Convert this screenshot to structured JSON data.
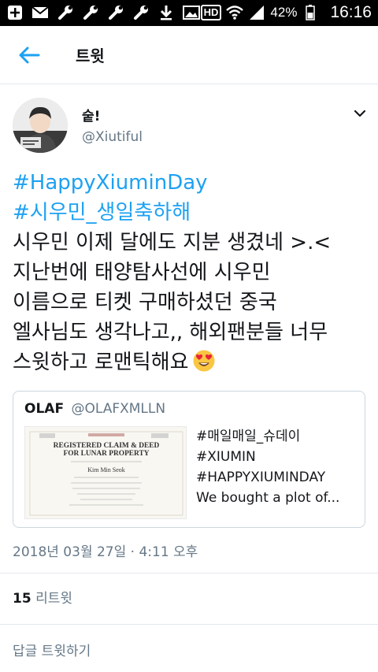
{
  "status_bar": {
    "battery": "42%",
    "time": "16:16",
    "network": "HD"
  },
  "header": {
    "title": "트윗"
  },
  "tweet": {
    "display_name": "숱!",
    "handle": "@Xiutiful",
    "hashtags": [
      "#HappyXiuminDay",
      "#시우민_생일축하해"
    ],
    "lines": [
      "시우민 이제 달에도 지분 생겼네 >.<",
      "지난번에 태양탐사선에 시우민",
      "이름으로 티켓 구매하셨던 중국",
      "엘사님도 생각나고,, 해외팬분들 너무",
      "스윗하고 로맨틱해요"
    ],
    "emoji": "heart-eyes-emoji",
    "timestamp": "2018년 03월 27일 · 4:11 오후"
  },
  "quote": {
    "name": "OLAF",
    "handle": "@OLAFXMLLN",
    "lines": [
      "#매일매일_슈데이",
      "#XIUMIN",
      "#HAPPYXIUMINDAY",
      "We bought a plot of..."
    ],
    "certificate": {
      "title_line1": "REGISTERED CLAIM & DEED",
      "title_line2": "FOR LUNAR PROPERTY",
      "owner": "Kim Min Seok"
    }
  },
  "stats": {
    "retweet_count": "15",
    "retweet_label": "리트윗"
  },
  "reply": {
    "label": "답글 트윗하기"
  },
  "colors": {
    "accent": "#1da1f2",
    "secondary_text": "#657786",
    "divider": "#e1e8ed"
  }
}
